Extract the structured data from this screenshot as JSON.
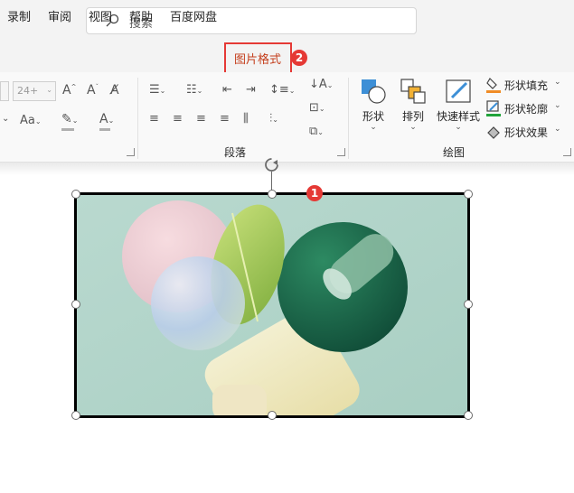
{
  "search": {
    "placeholder": "搜索"
  },
  "tabs": [
    {
      "label": "录制"
    },
    {
      "label": "审阅"
    },
    {
      "label": "视图"
    },
    {
      "label": "帮助"
    },
    {
      "label": "百度网盘"
    },
    {
      "label": "图片格式",
      "active": true
    }
  ],
  "badges": {
    "tab_step": "2",
    "image_step": "1"
  },
  "font_group": {
    "size_value": "24+"
  },
  "groups": {
    "paragraph": "段落",
    "drawing": "绘图"
  },
  "drawing": {
    "shape": "形状",
    "arrange": "排列",
    "quick_styles": "快速样式",
    "shape_fill": "形状填充",
    "shape_outline": "形状轮廓",
    "shape_effects": "形状效果"
  },
  "colors": {
    "accent": "#c43e1c",
    "highlight_red": "#e53935",
    "fill_orange": "#f08c26",
    "outline_green": "#20a33a"
  },
  "icons": [
    "search-icon",
    "shape-icon",
    "arrange-icon",
    "quick-styles-icon",
    "shape-fill-icon",
    "shape-outline-icon",
    "shape-effects-icon",
    "rotate-handle-icon"
  ]
}
